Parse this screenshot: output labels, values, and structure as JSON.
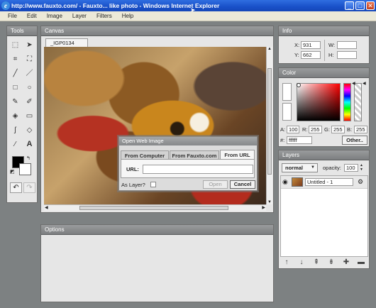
{
  "window": {
    "title": "http://www.fauxto.com/ - Fauxto... like photo - Windows Internet Explorer",
    "icon": "ie-icon",
    "buttons": [
      "minimize-icon",
      "maximize-icon",
      "close-icon"
    ]
  },
  "menu": [
    "File",
    "Edit",
    "Image",
    "Layer",
    "Filters",
    "Help"
  ],
  "panels": {
    "tools": "Tools",
    "canvas": "Canvas",
    "info": "Info",
    "color": "Color",
    "layers": "Layers",
    "options": "Options"
  },
  "canvas": {
    "doc_tab": "_IGP0134"
  },
  "info": {
    "x_label": "X:",
    "x": "931",
    "y_label": "Y:",
    "y": "662",
    "w_label": "W:",
    "w": "",
    "h_label": "H:",
    "h": ""
  },
  "color": {
    "alpha_label": "A:",
    "alpha": "100",
    "r_label": "R:",
    "r": "255",
    "g_label": "G:",
    "g": "255",
    "b_label": "B:",
    "b": "255",
    "hex_label": "#:",
    "hex": "ffffff",
    "other": "Other..",
    "foreground": "#000000",
    "background": "#ffffff"
  },
  "layers": {
    "blend_mode": "normal",
    "opacity_label": "opacity:",
    "opacity": "100",
    "items": [
      {
        "name": "Untitled - 1"
      }
    ]
  },
  "dialog": {
    "title": "Open Web Image",
    "tabs": [
      "From Computer",
      "From Fauxto.com",
      "From URL"
    ],
    "active_tab": 2,
    "url_label": "URL:",
    "url": "",
    "as_layer_label": "As Layer?",
    "open": "Open",
    "cancel": "Cancel"
  },
  "colors": {
    "titlebar": "#1950c8",
    "panel_header": "#8a8c8d",
    "panel_body": "#e6e6e6",
    "desktop": "#7d8182"
  }
}
